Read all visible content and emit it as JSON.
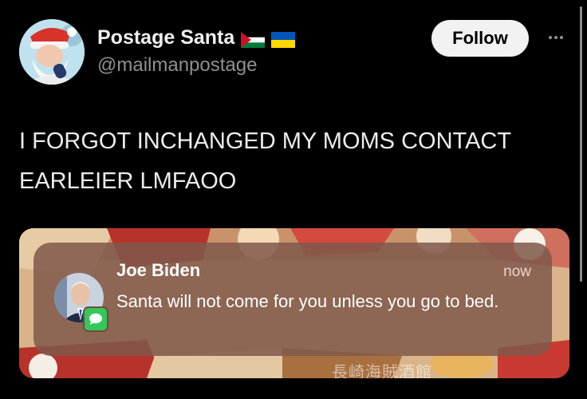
{
  "author": {
    "display_name": "Postage Santa",
    "handle": "@mailmanpostage",
    "flag_1": "palestine-flag-icon",
    "flag_2": "ukraine-flag-icon"
  },
  "actions": {
    "follow_label": "Follow",
    "more_icon": "more-icon"
  },
  "tweet": {
    "text": "I FORGOT INCHANGED MY MOMS CONTACT EARLEIER LMFAOO"
  },
  "notification": {
    "sender": "Joe Biden",
    "time": "now",
    "body": "Santa will not come for you unless you go to bed.",
    "app_icon": "messages-icon"
  },
  "media": {
    "watermark": "長崎海賊酒館"
  },
  "colors": {
    "background": "#000000",
    "follow_bg": "#f2f2f2",
    "notification_bg": "#80584c",
    "messages_green": "#34c759"
  }
}
